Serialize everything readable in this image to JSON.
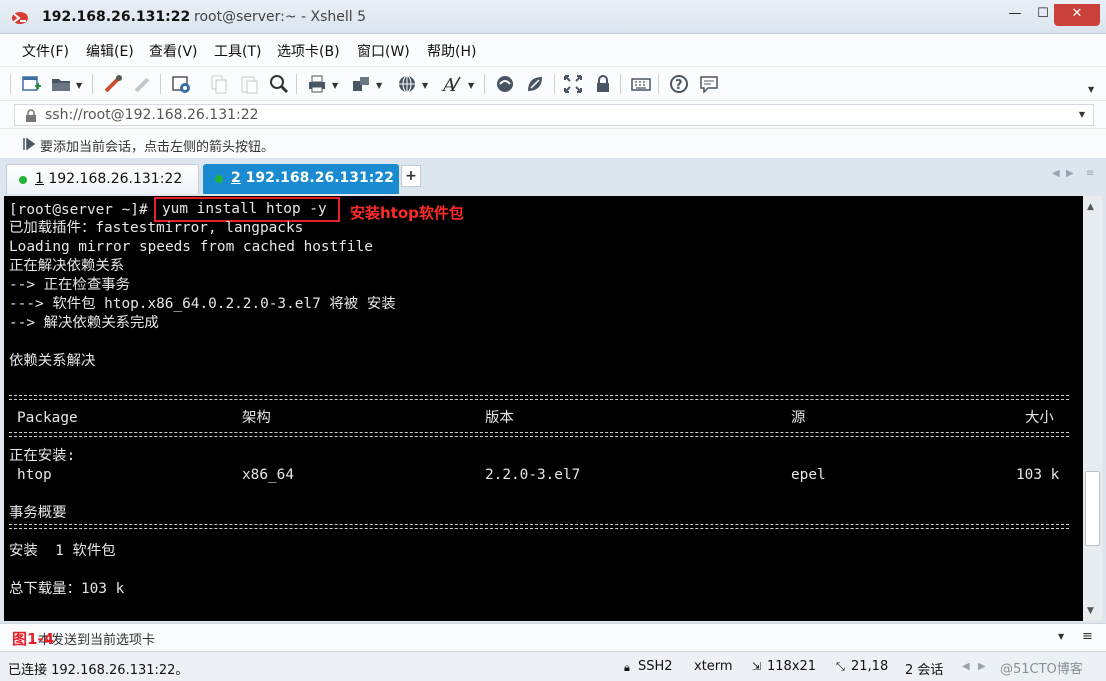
{
  "window": {
    "title_host": "192.168.26.131:22",
    "title_rest": "root@server:~ - Xshell 5",
    "min_glyph": "—",
    "max_glyph": "☐",
    "close_glyph": "✕"
  },
  "menu": [
    "文件(F)",
    "编辑(E)",
    "查看(V)",
    "工具(T)",
    "选项卡(B)",
    "窗口(W)",
    "帮助(H)"
  ],
  "toolbar_icons": [
    "new-session-icon",
    "open-folder-icon",
    "reconnect-icon",
    "disconnect-icon",
    "properties-icon",
    "copy-icon",
    "paste-icon",
    "find-icon",
    "print-icon",
    "transfer-icon",
    "globe-icon",
    "font-icon",
    "xftp-icon",
    "xmanager-icon",
    "fullscreen-icon",
    "lock-icon",
    "keyboard-icon",
    "help-icon",
    "chat-icon"
  ],
  "address": {
    "value": "ssh://root@192.168.26.131:22"
  },
  "hint": "要添加当前会话，点击左侧的箭头按钮。",
  "tabs": [
    {
      "num": "1",
      "label": " 192.168.26.131:22"
    },
    {
      "num": "2",
      "label": " 192.168.26.131:22"
    }
  ],
  "tab_add": "+",
  "terminal": {
    "prompt": "[root@server ~]#",
    "command": "yum install htop -y",
    "annotation": "安装htop软件包",
    "lines": [
      "已加载插件：fastestmirror, langpacks",
      "Loading mirror speeds from cached hostfile",
      "正在解决依赖关系",
      "--> 正在检查事务",
      "---> 软件包 htop.x86_64.0.2.2.0-3.el7 将被 安装",
      "--> 解决依赖关系完成",
      "依赖关系解决"
    ],
    "table_headers": [
      "Package",
      "架构",
      "版本",
      "源",
      "大小"
    ],
    "installing_label": "正在安装:",
    "package_row": [
      "htop",
      "x86_64",
      "2.2.0-3.el7",
      "epel",
      "103 k"
    ],
    "summary_label": "事务概要",
    "install_count": "安装  1 软件包",
    "total_download": "总下载量：103 k"
  },
  "sendbar": {
    "figure_label": "图1-4",
    "text": "本发送到当前选项卡"
  },
  "status": {
    "connected": "已连接 192.168.26.131:22。",
    "protocol": "SSH2",
    "term": "xterm",
    "size": "118x21",
    "cursor": "21,18",
    "sessions": "2 会话",
    "watermark": "@51CTO博客"
  },
  "colors": {
    "tab_active": "#1a8bd0",
    "annotation_red": "#ff2a2a",
    "terminal_bg": "#000000",
    "terminal_fg": "#e6e6e6"
  }
}
